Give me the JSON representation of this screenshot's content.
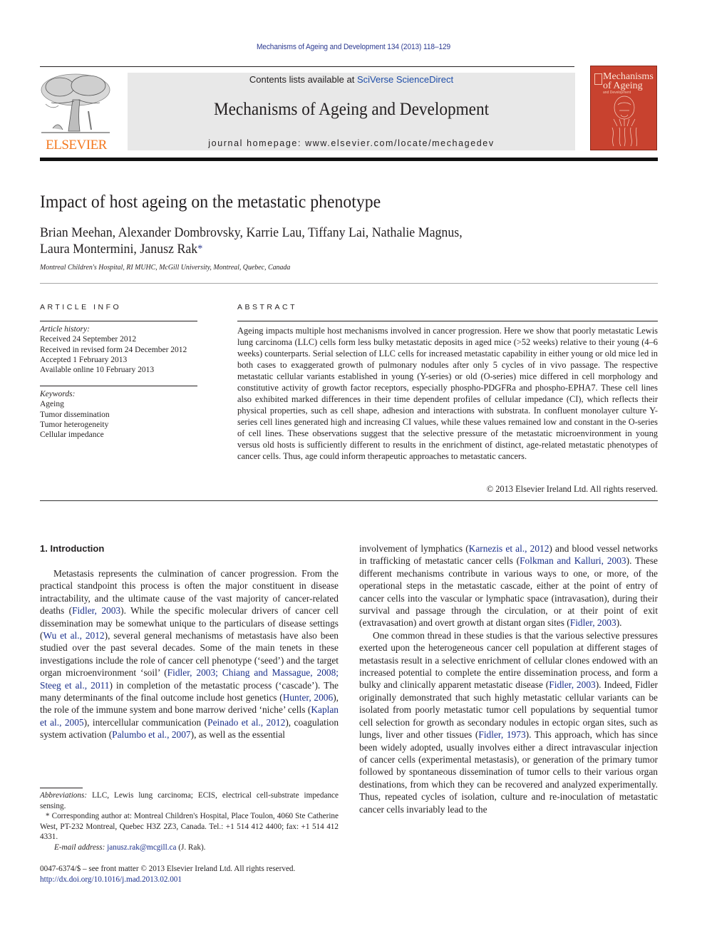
{
  "running_head": "Mechanisms of Ageing and Development 134 (2013) 118–129",
  "masthead": {
    "contents_prefix": "Contents lists available at ",
    "contents_link": "SciVerse ScienceDirect",
    "journal_title": "Mechanisms of Ageing and Development",
    "homepage": "journal homepage: www.elsevier.com/locate/mechagedev",
    "publisher_logo_text": "ELSEVIER",
    "cover": {
      "title_line1": "Mechanisms",
      "title_line2": "of Ageing",
      "subtitle": "and Development",
      "color": "#c8422f"
    }
  },
  "article": {
    "title": "Impact of host ageing on the metastatic phenotype",
    "authors_line1": "Brian Meehan, Alexander Dombrovsky, Karrie Lau, Tiffany Lai, Nathalie Magnus,",
    "authors_line2": "Laura Montermini, Janusz Rak",
    "corresponding_mark": "*",
    "affiliation": "Montreal Children's Hospital, RI MUHC, McGill University, Montreal, Quebec, Canada"
  },
  "article_info": {
    "heading": "ARTICLE INFO",
    "history_label": "Article history:",
    "history": [
      "Received 24 September 2012",
      "Received in revised form 24 December 2012",
      "Accepted 1 February 2013",
      "Available online 10 February 2013"
    ],
    "keywords_label": "Keywords:",
    "keywords": [
      "Ageing",
      "Tumor dissemination",
      "Tumor heterogeneity",
      "Cellular impedance"
    ]
  },
  "abstract": {
    "heading": "ABSTRACT",
    "text": "Ageing impacts multiple host mechanisms involved in cancer progression. Here we show that poorly metastatic Lewis lung carcinoma (LLC) cells form less bulky metastatic deposits in aged mice (>52 weeks) relative to their young (4–6 weeks) counterparts. Serial selection of LLC cells for increased metastatic capability in either young or old mice led in both cases to exaggerated growth of pulmonary nodules after only 5 cycles of in vivo passage. The respective metastatic cellular variants established in young (Y-series) or old (O-series) mice differed in cell morphology and constitutive activity of growth factor receptors, especially phospho-PDGFRa and phospho-EPHA7. These cell lines also exhibited marked differences in their time dependent profiles of cellular impedance (CI), which reflects their physical properties, such as cell shape, adhesion and interactions with substrata. In confluent monolayer culture Y-series cell lines generated high and increasing CI values, while these values remained low and constant in the O-series of cell lines. These observations suggest that the selective pressure of the metastatic microenvironment in young versus old hosts is sufficiently different to results in the enrichment of distinct, age-related metastatic phenotypes of cancer cells. Thus, age could inform therapeutic approaches to metastatic cancers.",
    "copyright": "© 2013 Elsevier Ireland Ltd. All rights reserved."
  },
  "introduction": {
    "heading": "1.  Introduction",
    "left_column": [
      {
        "t": "Metastasis represents the culmination of cancer progression. From the practical standpoint this process is often the major constituent in disease intractability, and the ultimate cause of the vast majority of cancer-related deaths ("
      },
      {
        "link": "Fidler, 2003"
      },
      {
        "t": "). While the specific molecular drivers of cancer cell dissemination may be somewhat unique to the particulars of disease settings ("
      },
      {
        "link": "Wu et al., 2012"
      },
      {
        "t": "), several general mechanisms of metastasis have also been studied over the past several decades. Some of the main tenets in these investigations include the role of cancer cell phenotype (‘seed’) and the target organ microenvironment ‘soil’ ("
      },
      {
        "link": "Fidler, 2003; Chiang and Massague, 2008; Steeg et al., 2011"
      },
      {
        "t": ") in completion of the metastatic process (‘cascade’). The many determinants of the final outcome include host genetics ("
      },
      {
        "link": "Hunter, 2006"
      },
      {
        "t": "), the role of the immune system and bone marrow derived ‘niche’ cells ("
      },
      {
        "link": "Kaplan et al., 2005"
      },
      {
        "t": "), intercellular communication ("
      },
      {
        "link": "Peinado et al., 2012"
      },
      {
        "t": "), coagulation system activation ("
      },
      {
        "link": "Palumbo et al., 2007"
      },
      {
        "t": "), as well as the essential"
      }
    ],
    "right_para1": [
      {
        "t": "involvement of lymphatics ("
      },
      {
        "link": "Karnezis et al., 2012"
      },
      {
        "t": ") and blood vessel networks in trafficking of metastatic cancer cells ("
      },
      {
        "link": "Folkman and Kalluri, 2003"
      },
      {
        "t": "). These different mechanisms contribute in various ways to one, or more, of the operational steps in the metastatic cascade, either at the point of entry of cancer cells into the vascular or lymphatic space (intravasation), during their survival and passage through the circulation, or at their point of exit (extravasation) and overt growth at distant organ sites ("
      },
      {
        "link": "Fidler, 2003"
      },
      {
        "t": ")."
      }
    ],
    "right_para2": [
      {
        "t": "One common thread in these studies is that the various selective pressures exerted upon the heterogeneous cancer cell population at different stages of metastasis result in a selective enrichment of cellular clones endowed with an increased potential to complete the entire dissemination process, and form a bulky and clinically apparent metastatic disease ("
      },
      {
        "link": "Fidler, 2003"
      },
      {
        "t": "). Indeed, Fidler originally demonstrated that such highly metastatic cellular variants can be isolated from poorly metastatic tumor cell populations by sequential tumor cell selection for growth as secondary nodules in ectopic organ sites, such as lungs, liver and other tissues ("
      },
      {
        "link": "Fidler, 1973"
      },
      {
        "t": "). This approach, which has since been widely adopted, usually involves either a direct intravascular injection of cancer cells (experimental metastasis), or generation of the primary tumor followed by spontaneous dissemination of tumor cells to their various organ destinations, from which they can be recovered and analyzed experimentally. Thus, repeated cycles of isolation, culture and re-inoculation of metastatic cancer cells invariably lead to the"
      }
    ]
  },
  "footnotes": {
    "abbrev_label": "Abbreviations:",
    "abbrev_text": " LLC, Lewis lung carcinoma; ECIS, electrical cell-substrate impedance sensing.",
    "corresponding": "* Corresponding author at: Montreal Children's Hospital, Place Toulon, 4060 Ste Catherine West, PT-232 Montreal, Quebec H3Z 2Z3, Canada. Tel.: +1 514 412 4400; fax: +1 514 412 4331.",
    "email_label": "E-mail address:",
    "email": "janusz.rak@mcgill.ca",
    "email_suffix": " (J. Rak)."
  },
  "front_matter": {
    "issn_line": "0047-6374/$ – see front matter © 2013 Elsevier Ireland Ltd. All rights reserved.",
    "doi": "http://dx.doi.org/10.1016/j.mad.2013.02.001"
  }
}
